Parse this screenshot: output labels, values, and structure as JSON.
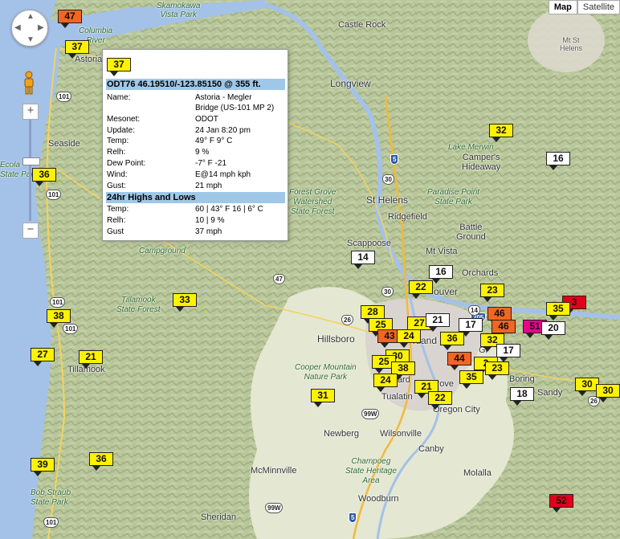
{
  "map_type": {
    "map_label": "Map",
    "satellite_label": "Satellite",
    "active": "Map"
  },
  "places": [
    {
      "name": "Skamokawa Vista Park",
      "lines": [
        "Skamokawa",
        "Vista Park"
      ],
      "green": true
    },
    {
      "name": "Columbia River",
      "lines": [
        "Columbia",
        "River"
      ],
      "green": true
    },
    {
      "name": "Astoria"
    },
    {
      "name": "Castle Rock"
    },
    {
      "name": "Mt St Helens",
      "lines": [
        "Mt St",
        "Helens"
      ]
    },
    {
      "name": "Longview"
    },
    {
      "name": "Seaside"
    },
    {
      "name": "Ecola State Park",
      "lines": [
        "Ecola",
        "State Park"
      ],
      "green": true
    },
    {
      "name": "Lake Merwin"
    },
    {
      "name": "Campers Hideaway",
      "lines": [
        "Camper's",
        "Hideaway"
      ]
    },
    {
      "name": "Forest Grove Watershed State Forest",
      "lines": [
        "Forest Grove",
        "Watershed",
        "State Forest"
      ],
      "green": true
    },
    {
      "name": "St Helens"
    },
    {
      "name": "Paradise Point State Park",
      "lines": [
        "Paradise Point",
        "State Park"
      ],
      "green": true
    },
    {
      "name": "Ridgefield"
    },
    {
      "name": "Battle Ground",
      "lines": [
        "Battle",
        "Ground"
      ]
    },
    {
      "name": "Scappoose"
    },
    {
      "name": "Mt Vista"
    },
    {
      "name": "Orchards"
    },
    {
      "name": "Tillamook State Forest",
      "lines": [
        "Tillamook",
        "State Forest"
      ],
      "green": true
    },
    {
      "name": "Hillsboro"
    },
    {
      "name": "Vancouver",
      "display": "ouver"
    },
    {
      "name": "Portland",
      "display": "rtland"
    },
    {
      "name": "Cooper Mountain Nature Park",
      "lines": [
        "Cooper Mountain",
        "Nature Park"
      ],
      "green": true
    },
    {
      "name": "Boring"
    },
    {
      "name": "Gresham",
      "display": "Gr"
    },
    {
      "name": "Sandy"
    },
    {
      "name": "Tualatin"
    },
    {
      "name": "Gladstone",
      "display": "stone"
    },
    {
      "name": "Oregon City",
      "display": "Oregon City"
    },
    {
      "name": "Tillamook",
      "display": "Tillamook"
    },
    {
      "name": "Newberg"
    },
    {
      "name": "Wilsonville"
    },
    {
      "name": "Canby"
    },
    {
      "name": "Champoeg State Heritage Area",
      "lines": [
        "Champoeg",
        "State Heritage",
        "Area"
      ],
      "green": true
    },
    {
      "name": "Molalla"
    },
    {
      "name": "McMinnville"
    },
    {
      "name": "Bob Straub State Park",
      "lines": [
        "Bob Straub",
        "State Park"
      ],
      "green": true
    },
    {
      "name": "Sheridan"
    },
    {
      "name": "Woodburn"
    },
    {
      "name": "Campground",
      "display": "Campground"
    },
    {
      "name": "Sherwood",
      "display": "ward"
    },
    {
      "name": "Grove",
      "display": "Grove"
    }
  ],
  "routes": [
    "101",
    "101",
    "101",
    "101",
    "101",
    "30",
    "5",
    "47",
    "26",
    "99W",
    "99W",
    "205",
    "5",
    "26",
    "14",
    "30"
  ],
  "stations": [
    {
      "value": "47",
      "color": "orange"
    },
    {
      "value": "37",
      "color": "yellow"
    },
    {
      "value": "36",
      "color": "yellow"
    },
    {
      "value": "32",
      "color": "yellow"
    },
    {
      "value": "16",
      "color": "white"
    },
    {
      "value": "14",
      "color": "white"
    },
    {
      "value": "16",
      "color": "white"
    },
    {
      "value": "22",
      "color": "yellow"
    },
    {
      "value": "23",
      "color": "yellow"
    },
    {
      "value": "33",
      "color": "yellow"
    },
    {
      "value": "38",
      "color": "yellow"
    },
    {
      "value": "27",
      "color": "yellow"
    },
    {
      "value": "21",
      "color": "yellow"
    },
    {
      "value": "28",
      "color": "yellow"
    },
    {
      "value": "25",
      "color": "yellow"
    },
    {
      "value": "43",
      "color": "orange"
    },
    {
      "value": "24",
      "color": "yellow"
    },
    {
      "value": "27",
      "color": "yellow"
    },
    {
      "value": "21",
      "color": "white"
    },
    {
      "value": "17",
      "color": "white"
    },
    {
      "value": "36",
      "color": "yellow"
    },
    {
      "value": "46",
      "color": "orange"
    },
    {
      "value": "51",
      "color": "pink"
    },
    {
      "value": "35",
      "color": "yellow"
    },
    {
      "value": "20",
      "color": "white"
    },
    {
      "value": "32",
      "color": "yellow"
    },
    {
      "value": "17",
      "color": "white"
    },
    {
      "value": "30",
      "color": "yellow"
    },
    {
      "value": "25",
      "color": "yellow"
    },
    {
      "value": "38",
      "color": "yellow"
    },
    {
      "value": "44",
      "color": "orange"
    },
    {
      "value": "24",
      "color": "yellow"
    },
    {
      "value": "2",
      "color": "yellow"
    },
    {
      "value": "23",
      "color": "yellow"
    },
    {
      "value": "35",
      "color": "yellow"
    },
    {
      "value": "21",
      "color": "yellow"
    },
    {
      "value": "22",
      "color": "yellow"
    },
    {
      "value": "18",
      "color": "white"
    },
    {
      "value": "30",
      "color": "yellow"
    },
    {
      "value": "30",
      "color": "yellow"
    },
    {
      "value": "31",
      "color": "yellow"
    },
    {
      "value": "36",
      "color": "yellow"
    },
    {
      "value": "39",
      "color": "yellow"
    },
    {
      "value": "52",
      "color": "red"
    },
    {
      "value": "27",
      "color": "yellow"
    },
    {
      "value": "21",
      "color": "yellow"
    },
    {
      "value": "3",
      "color": "red"
    }
  ],
  "popup": {
    "marker_value": "37",
    "title": "ODT76 46.19510/-123.85150 @ 355 ft.",
    "name_label": "Name:",
    "name_value": "Astoria - Megler Bridge (US-101 MP 2)",
    "name_line1": "Astoria - Megler",
    "name_line2": "Bridge (US-101 MP 2)",
    "mesonet_label": "Mesonet:",
    "mesonet_value": "ODOT",
    "update_label": "Update:",
    "update_value": "24 Jan 8:20 pm",
    "temp_label": "Temp:",
    "temp_value": "49° F  9° C",
    "relh_label": "Relh:",
    "relh_value": "9 %",
    "dew_label": "Dew Point:",
    "dew_value": "-7° F  -21",
    "wind_label": "Wind:",
    "wind_value": "E@14 mph kph",
    "gust_label": "Gust:",
    "gust_value": "21 mph",
    "section2": "24hr Highs and Lows",
    "temp2_label": "Temp:",
    "temp2_value": "60 | 43° F  16 | 6° C",
    "relh2_label": "Relh:",
    "relh2_value": "10 | 9 %",
    "gust2_label": "Gust",
    "gust2_value": "37 mph"
  }
}
